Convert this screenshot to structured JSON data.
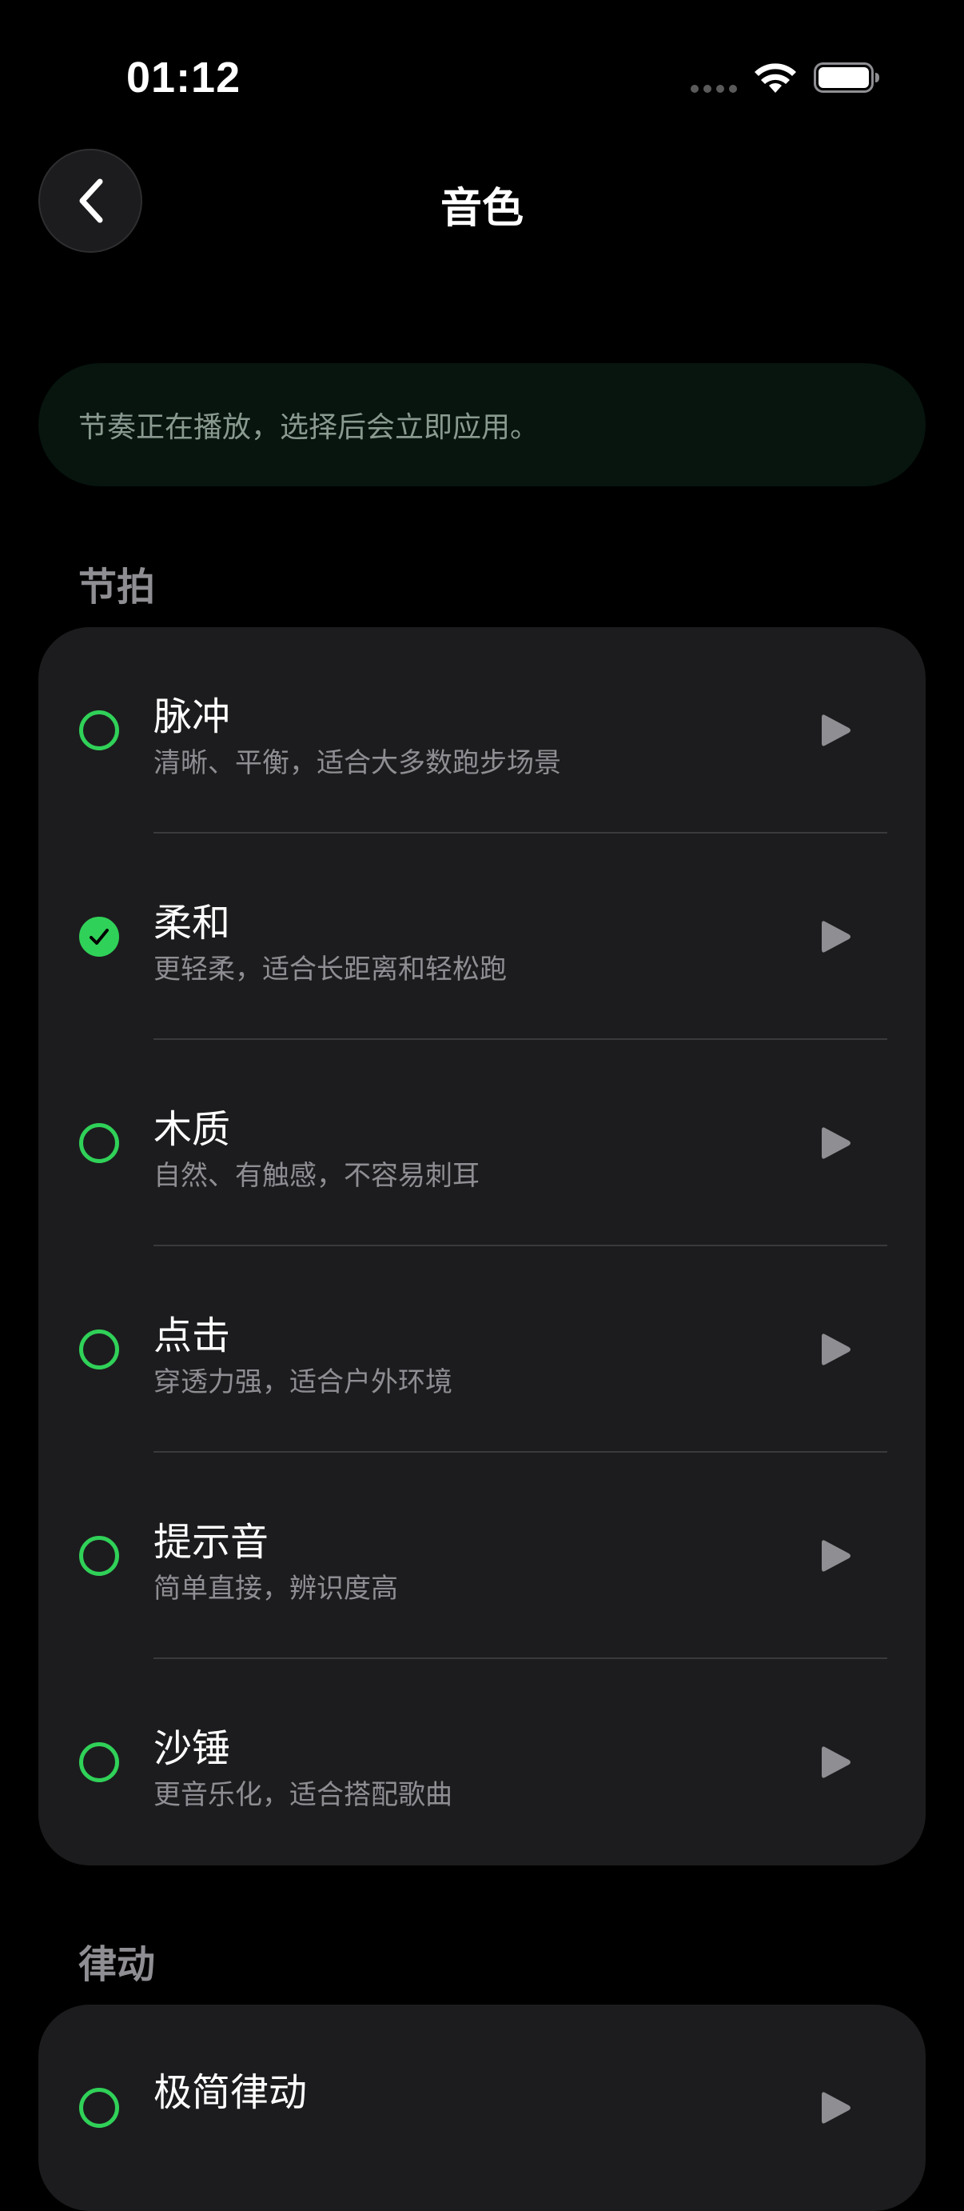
{
  "status_bar": {
    "time": "01:12"
  },
  "header": {
    "title": "音色",
    "back_icon": "chevron-left-icon"
  },
  "banner": {
    "text": "节奏正在播放，选择后会立即应用。"
  },
  "sections": [
    {
      "title": "节拍",
      "items": [
        {
          "title": "脉冲",
          "subtitle": "清晰、平衡，适合大多数跑步场景",
          "selected": false
        },
        {
          "title": "柔和",
          "subtitle": "更轻柔，适合长距离和轻松跑",
          "selected": true
        },
        {
          "title": "木质",
          "subtitle": "自然、有触感，不容易刺耳",
          "selected": false
        },
        {
          "title": "点击",
          "subtitle": "穿透力强，适合户外环境",
          "selected": false
        },
        {
          "title": "提示音",
          "subtitle": "简单直接，辨识度高",
          "selected": false
        },
        {
          "title": "沙锤",
          "subtitle": "更音乐化，适合搭配歌曲",
          "selected": false
        }
      ]
    },
    {
      "title": "律动",
      "items": [
        {
          "title": "极简律动",
          "subtitle": "",
          "selected": false
        }
      ]
    }
  ],
  "colors": {
    "accent": "#30d158",
    "background": "#000000",
    "card": "#1c1c1e",
    "secondary_text": "#8e8e93",
    "play_icon": "#8e8e93"
  }
}
